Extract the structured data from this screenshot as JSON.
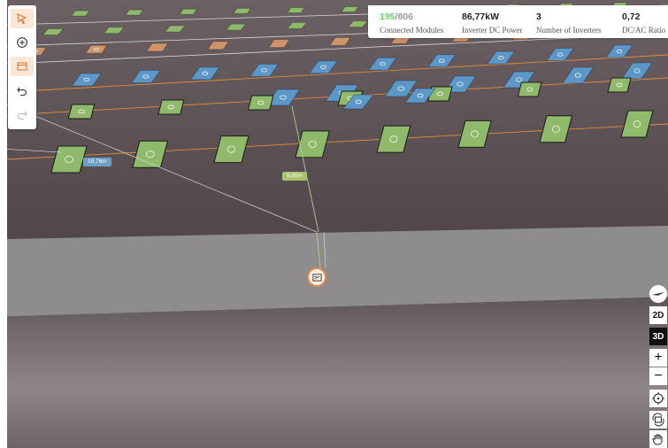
{
  "stats": {
    "connected_modules": {
      "connected": "195",
      "separator": "/",
      "total": "806",
      "label": "Connected Modules"
    },
    "inverter_dc_power": {
      "value": "86,77kW",
      "label": "Inverter DC Power"
    },
    "number_of_inverters": {
      "value": "3",
      "label": "Number of Inverters"
    },
    "dc_ac_ratio": {
      "value": "0,72",
      "label": "DC/AC Ratio"
    }
  },
  "view_modes": {
    "two_d": "2D",
    "three_d": "3D"
  },
  "zoom": {
    "plus": "+",
    "minus": "−"
  },
  "distance_labels": {
    "first": "19,76m",
    "second": "9,95m"
  },
  "colors": {
    "accent": "#e08c4c",
    "connected_module": "#8fb96b",
    "unconnected_module": "#5b97c9",
    "other_inverter_module": "#d0946a",
    "roof": "#544a4d",
    "ground_band": "#8d8b8b"
  },
  "icons": {
    "tools": [
      "select-arrow-icon",
      "add-circle-icon",
      "panel-frame-icon",
      "undo-icon",
      "redo-icon"
    ],
    "controls": [
      "compass-icon",
      "locate-target-icon",
      "rotate-view-icon",
      "pan-hand-icon"
    ]
  }
}
